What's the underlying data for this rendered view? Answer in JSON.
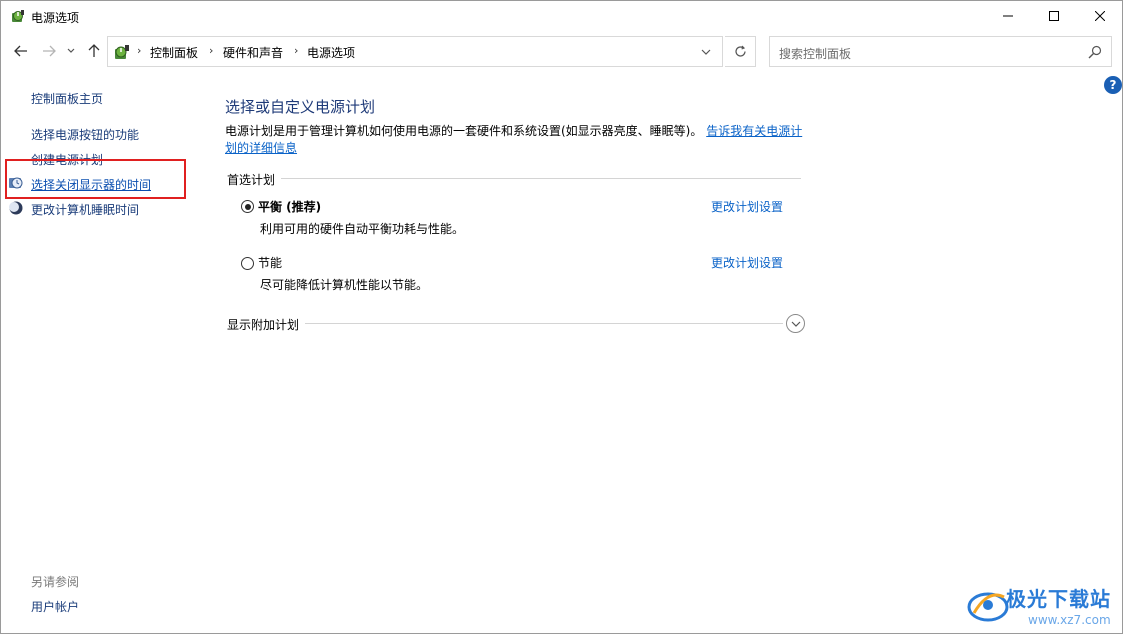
{
  "window": {
    "title": "电源选项",
    "icon": "power-options-icon"
  },
  "address": {
    "crumbs": [
      "控制面板",
      "硬件和声音",
      "电源选项"
    ],
    "search_placeholder": "搜索控制面板"
  },
  "help": {
    "label": "?"
  },
  "left_pane": {
    "home_link": "控制面板主页",
    "links": [
      "选择电源按钮的功能",
      "创建电源计划",
      "选择关闭显示器的时间",
      "更改计算机睡眠时间"
    ],
    "see_also_label": "另请参阅",
    "see_also_links": [
      "用户帐户"
    ]
  },
  "main": {
    "title": "选择或自定义电源计划",
    "description": "电源计划是用于管理计算机如何使用电源的一套硬件和系统设置(如显示器亮度、睡眠等)。",
    "description_link": "告诉我有关电源计划的详细信息",
    "preferred_label": "首选计划",
    "plans": [
      {
        "name": "平衡 (推荐)",
        "desc": "利用可用的硬件自动平衡功耗与性能。",
        "link": "更改计划设置",
        "selected": true
      },
      {
        "name": "节能",
        "desc": "尽可能降低计算机性能以节能。",
        "link": "更改计划设置",
        "selected": false
      }
    ],
    "more_plans_label": "显示附加计划"
  },
  "watermark": {
    "text": "极光下载站",
    "url": "www.xz7.com"
  },
  "colors": {
    "link": "#1a3c7a",
    "accent_link": "#0b63c8",
    "title": "#1e3a78",
    "highlight": "#e02020"
  }
}
